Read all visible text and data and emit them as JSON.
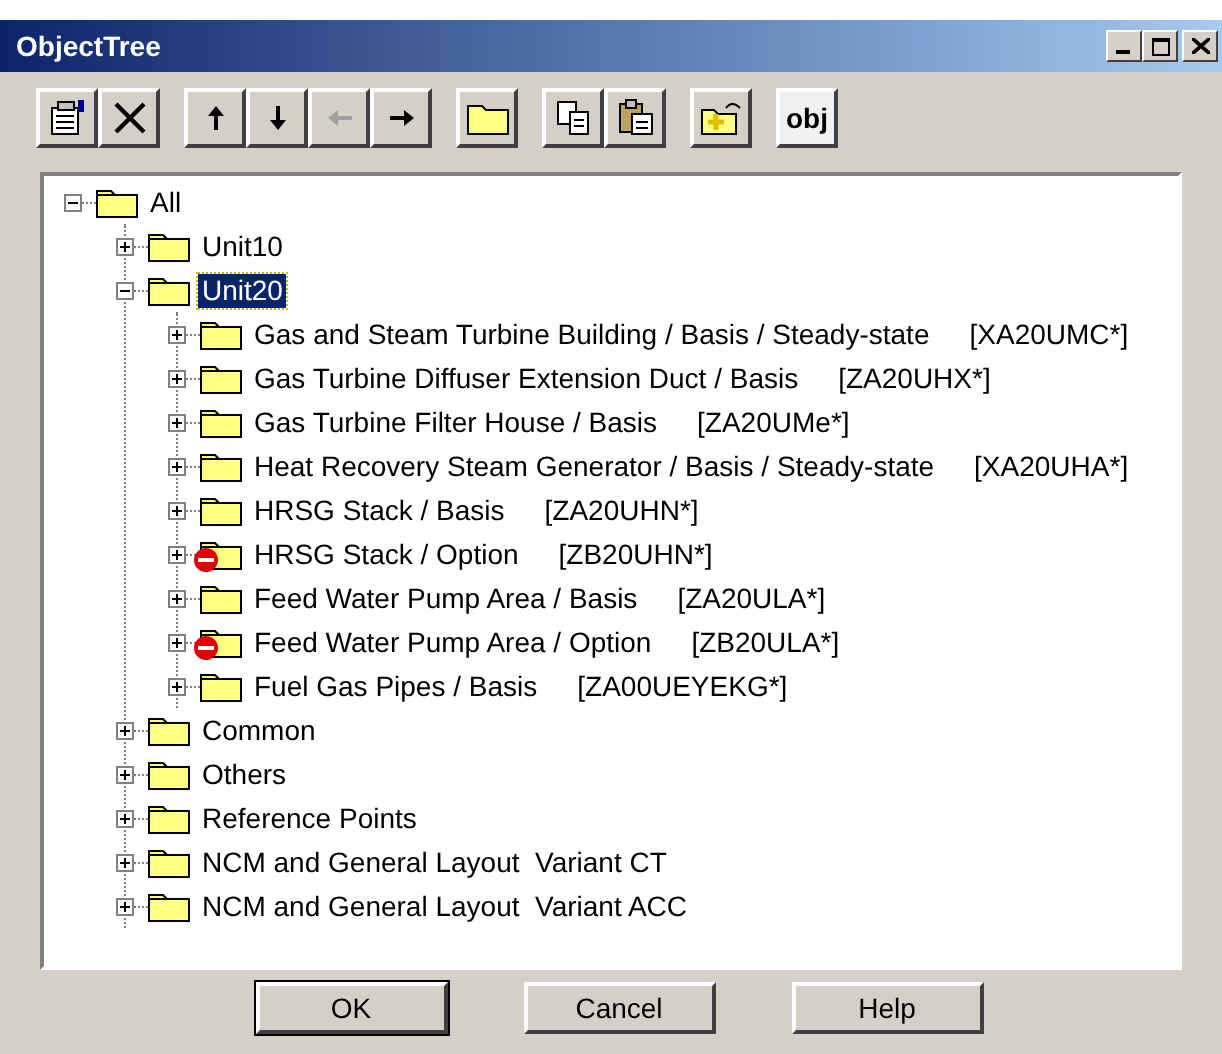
{
  "window": {
    "title": "ObjectTree"
  },
  "title_buttons": [
    {
      "kind": "minimize"
    },
    {
      "kind": "maximize"
    },
    {
      "kind": "close"
    }
  ],
  "toolbar": [
    [
      {
        "kind": "properties"
      },
      {
        "kind": "delete"
      }
    ],
    [
      {
        "kind": "up",
        "disabled": false
      },
      {
        "kind": "down",
        "disabled": false
      },
      {
        "kind": "left",
        "disabled": true
      },
      {
        "kind": "right",
        "disabled": false
      }
    ],
    [
      {
        "kind": "folder"
      }
    ],
    [
      {
        "kind": "copy"
      },
      {
        "kind": "paste"
      }
    ],
    [
      {
        "kind": "new-folder"
      }
    ],
    [
      {
        "kind": "text",
        "label": "obj"
      }
    ]
  ],
  "tree": [
    {
      "label": "All",
      "expanded": true,
      "selected": false,
      "blocked": false,
      "children": [
        {
          "label": "Unit10",
          "expanded": false,
          "selected": false,
          "blocked": false
        },
        {
          "label": "Unit20",
          "expanded": true,
          "selected": true,
          "blocked": false,
          "children": [
            {
              "label": "Gas and Steam Turbine Building / Basis / Steady-state",
              "code": "[XA20UMC*]",
              "expanded": false,
              "selected": false,
              "blocked": false
            },
            {
              "label": "Gas Turbine Diffuser Extension Duct / Basis",
              "code": "[ZA20UHX*]",
              "expanded": false,
              "selected": false,
              "blocked": false
            },
            {
              "label": "Gas Turbine Filter House / Basis",
              "code": "[ZA20UMe*]",
              "expanded": false,
              "selected": false,
              "blocked": false
            },
            {
              "label": "Heat Recovery Steam Generator / Basis / Steady-state",
              "code": "[XA20UHA*]",
              "expanded": false,
              "selected": false,
              "blocked": false
            },
            {
              "label": "HRSG Stack / Basis",
              "code": "[ZA20UHN*]",
              "expanded": false,
              "selected": false,
              "blocked": false
            },
            {
              "label": "HRSG Stack / Option",
              "code": "[ZB20UHN*]",
              "expanded": false,
              "selected": false,
              "blocked": true
            },
            {
              "label": "Feed Water Pump Area / Basis",
              "code": "[ZA20ULA*]",
              "expanded": false,
              "selected": false,
              "blocked": false
            },
            {
              "label": "Feed Water Pump Area / Option",
              "code": "[ZB20ULA*]",
              "expanded": false,
              "selected": false,
              "blocked": true
            },
            {
              "label": "Fuel Gas Pipes / Basis",
              "code": "[ZA00UEYEKG*]",
              "expanded": false,
              "selected": false,
              "blocked": false
            }
          ]
        },
        {
          "label": "Common",
          "expanded": false,
          "selected": false,
          "blocked": false
        },
        {
          "label": "Others",
          "expanded": false,
          "selected": false,
          "blocked": false
        },
        {
          "label": "Reference Points",
          "expanded": false,
          "selected": false,
          "blocked": false
        },
        {
          "label": "NCM and General Layout  Variant CT",
          "expanded": false,
          "selected": false,
          "blocked": false
        },
        {
          "label": "NCM and General Layout  Variant ACC",
          "expanded": false,
          "selected": false,
          "blocked": false
        }
      ]
    }
  ],
  "buttons": [
    {
      "label": "OK",
      "default": true
    },
    {
      "label": "Cancel",
      "default": false
    },
    {
      "label": "Help",
      "default": false
    }
  ]
}
